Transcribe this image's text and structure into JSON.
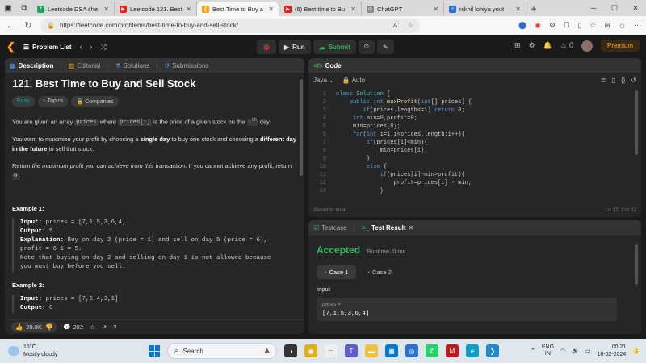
{
  "browser": {
    "tabs": [
      {
        "label": "Leetcode DSA she",
        "fav_color": "#1fa463",
        "fav_glyph": "+"
      },
      {
        "label": "Leetcode 121. Best",
        "fav_color": "#e62117",
        "fav_glyph": "▶"
      },
      {
        "label": "Best Time to Buy a",
        "fav_color": "#ffa116",
        "fav_glyph": "❮",
        "active": true
      },
      {
        "label": "(5) Best time to Bu",
        "fav_color": "#e62117",
        "fav_glyph": "▶"
      },
      {
        "label": "ChatGPT",
        "fav_color": "#888888",
        "fav_glyph": "◎"
      },
      {
        "label": "nikhil lohiya yout",
        "fav_color": "#2a6fd6",
        "fav_glyph": "⌕"
      }
    ],
    "new_tab": "+",
    "url": "https://leetcode.com/problems/best-time-to-buy-and-sell-stock/",
    "read_aloud": "Aˆ"
  },
  "lc_nav": {
    "problem_list": "Problem List",
    "run": "Run",
    "submit": "Submit",
    "streak": "0",
    "premium": "Premium"
  },
  "description_panel": {
    "tabs": [
      "Description",
      "Editorial",
      "Solutions",
      "Submissions"
    ],
    "title": "121. Best Time to Buy and Sell Stock",
    "difficulty": "Easy",
    "tag_topics": "Topics",
    "tag_companies": "Companies",
    "p1_a": "You are given an array ",
    "p1_code1": "prices",
    "p1_b": " where ",
    "p1_code2": "prices[i]",
    "p1_c": " is the price of a given stock on the ",
    "p1_code3": "i",
    "p1_sup": "th",
    "p1_d": " day.",
    "p2_a": "You want to maximize your profit by choosing a ",
    "p2_b1": "single day",
    "p2_c": " to buy one stock and choosing a ",
    "p2_b2": "different day in the future",
    "p2_d": " to sell that stock.",
    "p3_a": "Return ",
    "p3_i": "the maximum profit you can achieve from this transaction",
    "p3_b": ". If you cannot achieve any profit, return ",
    "p3_code": "0",
    "p3_c": ".",
    "ex1_head": "Example 1:",
    "ex1_input_k": "Input:",
    "ex1_input_v": " prices = [7,1,5,3,6,4]",
    "ex1_output_k": "Output:",
    "ex1_output_v": " 5",
    "ex1_expl_k": "Explanation:",
    "ex1_expl_v": " Buy on day 2 (price = 1) and sell on day 5 (price = 6),",
    "ex1_expl_v2": "profit = 6-1 = 5.",
    "ex1_note1": "Note that buying on day 2 and selling on day 1 is not allowed because",
    "ex1_note2": "you must buy before you sell.",
    "ex2_head": "Example 2:",
    "ex2_input_k": "Input:",
    "ex2_input_v": " prices = [7,6,4,3,1]",
    "ex2_output_k": "Output:",
    "ex2_output_v": " 0",
    "likes": "29.9K",
    "comments": "282"
  },
  "code_panel": {
    "title": "Code",
    "language": "Java",
    "mode": "Auto",
    "lines": [
      {
        "n": "1",
        "indent": "",
        "tokens": [
          [
            "kw",
            "class "
          ],
          [
            "ty",
            "Solution "
          ],
          [
            "tx",
            "{"
          ]
        ]
      },
      {
        "n": "2",
        "indent": "    ",
        "tokens": [
          [
            "kw",
            "public int "
          ],
          [
            "fn",
            "maxProfit"
          ],
          [
            "tx",
            "("
          ],
          [
            "kw",
            "int"
          ],
          [
            "tx",
            "[] prices) {"
          ]
        ]
      },
      {
        "n": "3",
        "indent": "        ",
        "tokens": [
          [
            "kw",
            "if"
          ],
          [
            "tx",
            "(prices.length<="
          ],
          [
            "nm",
            "1"
          ],
          [
            "tx",
            ") "
          ],
          [
            "kw",
            "return "
          ],
          [
            "nm",
            "0"
          ],
          [
            "tx",
            ";"
          ]
        ]
      },
      {
        "n": "4",
        "indent": "     ",
        "tokens": [
          [
            "kw",
            "int "
          ],
          [
            "tx",
            "min="
          ],
          [
            "nm",
            "0"
          ],
          [
            "tx",
            ",profit="
          ],
          [
            "nm",
            "0"
          ],
          [
            "tx",
            ";"
          ]
        ]
      },
      {
        "n": "5",
        "indent": "     ",
        "tokens": [
          [
            "tx",
            "min=prices["
          ],
          [
            "nm",
            "0"
          ],
          [
            "tx",
            "];"
          ]
        ]
      },
      {
        "n": "6",
        "indent": "     ",
        "tokens": [
          [
            "kw",
            "for"
          ],
          [
            "tx",
            "("
          ],
          [
            "kw",
            "int "
          ],
          [
            "tx",
            "i="
          ],
          [
            "nm",
            "1"
          ],
          [
            "tx",
            ";i<prices.length;i++){"
          ]
        ]
      },
      {
        "n": "7",
        "indent": "         ",
        "tokens": [
          [
            "kw",
            "if"
          ],
          [
            "tx",
            "(prices[i]<min){"
          ]
        ]
      },
      {
        "n": "8",
        "indent": "             ",
        "tokens": [
          [
            "tx",
            "min=prices[i];"
          ]
        ]
      },
      {
        "n": "9",
        "indent": "         ",
        "tokens": [
          [
            "tx",
            "}"
          ]
        ]
      },
      {
        "n": "10",
        "indent": "         ",
        "tokens": [
          [
            "kw",
            "else "
          ],
          [
            "tx",
            "{"
          ]
        ]
      },
      {
        "n": "11",
        "indent": "             ",
        "tokens": [
          [
            "kw",
            "if"
          ],
          [
            "tx",
            "(prices[i]-min>profit){"
          ]
        ]
      },
      {
        "n": "12",
        "indent": "                 ",
        "tokens": [
          [
            "tx",
            "profit=prices[i] - min;"
          ]
        ]
      },
      {
        "n": "13",
        "indent": "             ",
        "tokens": [
          [
            "tx",
            "}"
          ]
        ]
      }
    ],
    "saved": "Saved to local",
    "cursor": "Ln 17, Col 22"
  },
  "result_panel": {
    "tab_testcase": "Testcase",
    "tab_result": "Test Result",
    "status": "Accepted",
    "runtime": "Runtime: 0 ms",
    "case1": "Case 1",
    "case2": "Case 2",
    "input_label": "Input",
    "input_key": "prices =",
    "input_value": "[7,1,5,3,6,4]"
  },
  "taskbar": {
    "temp": "15°C",
    "weather": "Mostly cloudy",
    "search": "Search",
    "lang1": "ENG",
    "lang2": "IN",
    "time": "00:21",
    "date": "18-02-2024"
  },
  "colors": {
    "accent": "#ffa116",
    "success": "#2cbb5d",
    "easy": "#00b8a3"
  }
}
